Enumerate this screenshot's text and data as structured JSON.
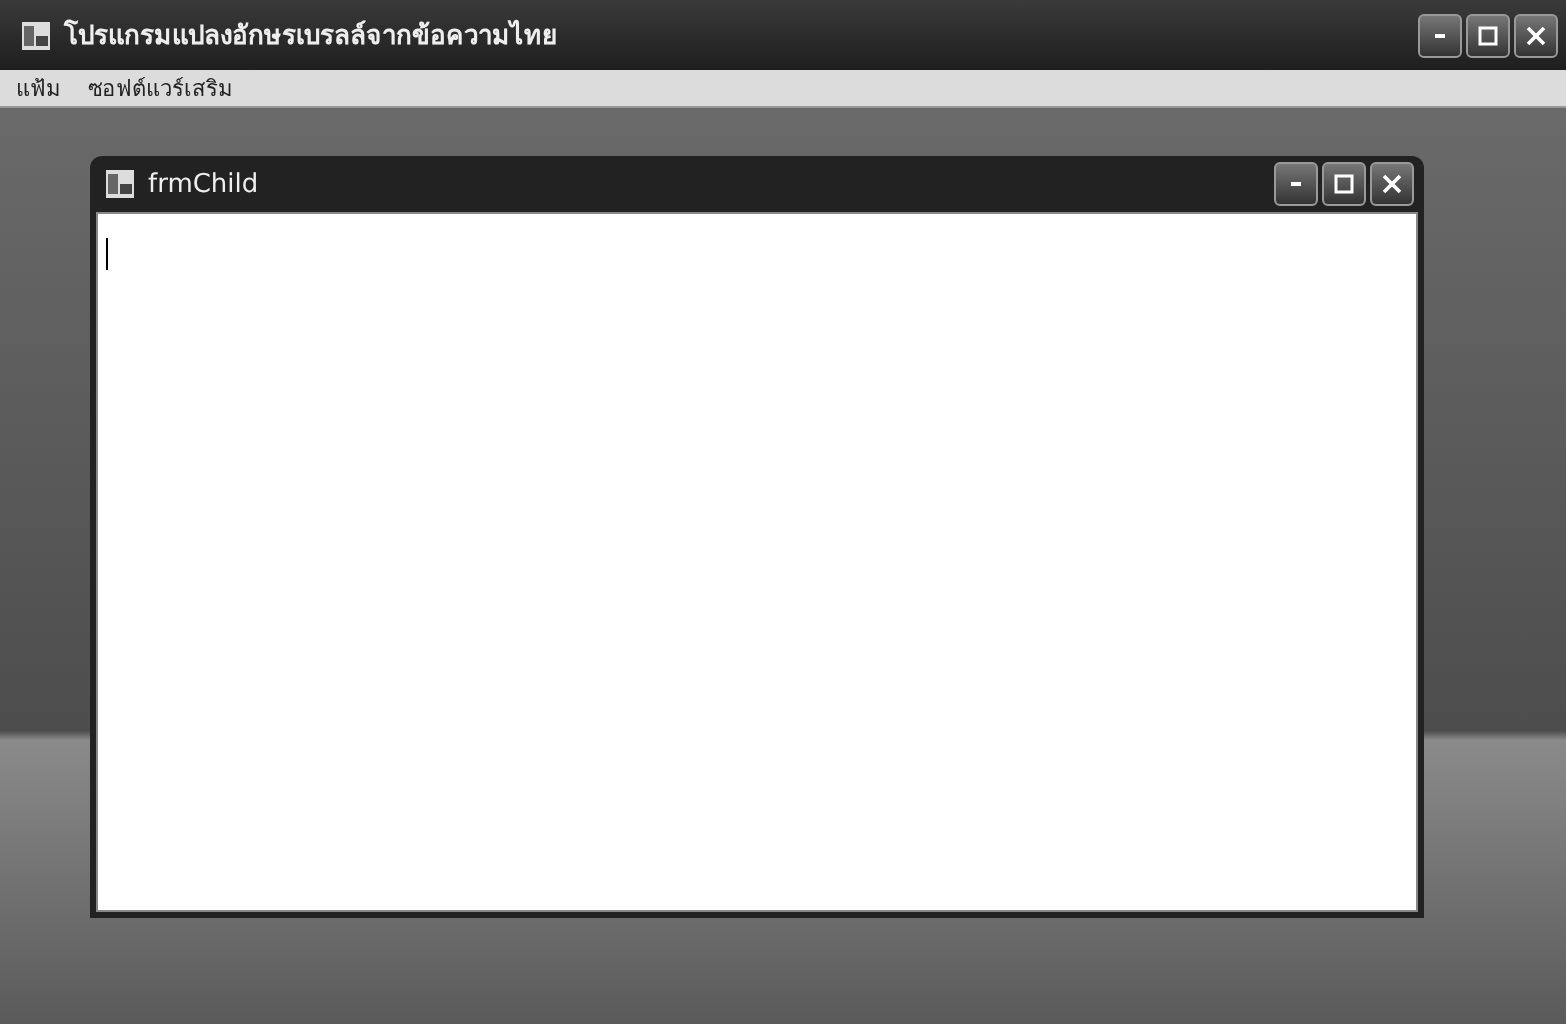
{
  "window": {
    "title": "โปรแกรมแปลงอักษรเบรลล์จากข้อความไทย"
  },
  "menu": [
    {
      "label": "แฟ้ม"
    },
    {
      "label": "ซอฟต์แวร์เสริม"
    }
  ],
  "child_window": {
    "title": "frmChild"
  }
}
